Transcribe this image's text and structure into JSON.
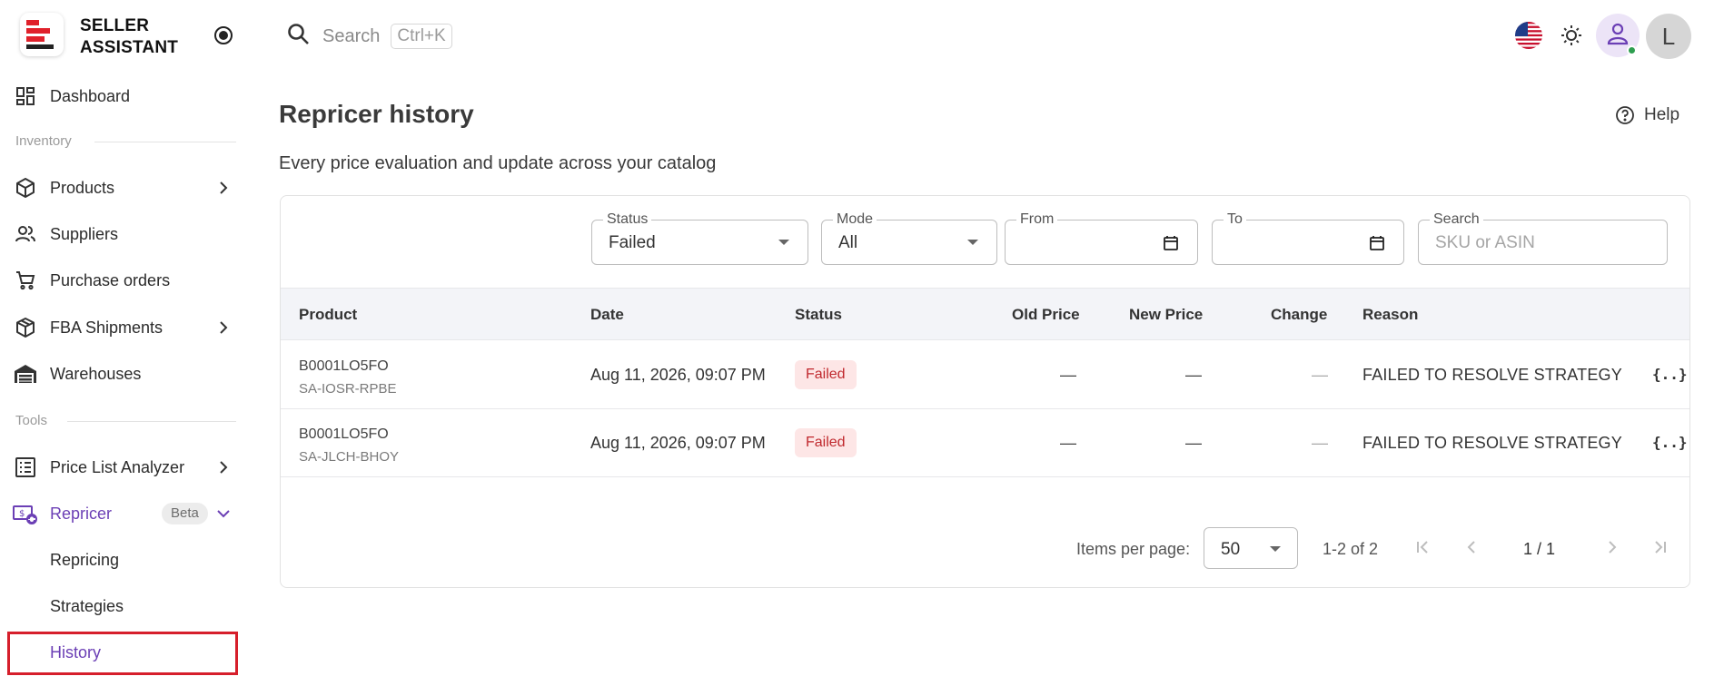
{
  "brand": {
    "line1": "SELLER",
    "line2": "ASSISTANT"
  },
  "search": {
    "placeholder": "Search",
    "shortcut": "Ctrl+K"
  },
  "header": {
    "avatar_letter": "L"
  },
  "sidebar": {
    "dashboard": "Dashboard",
    "inventory_section": "Inventory",
    "products": "Products",
    "suppliers": "Suppliers",
    "purchase_orders": "Purchase orders",
    "fba_shipments": "FBA Shipments",
    "warehouses": "Warehouses",
    "tools_section": "Tools",
    "price_list_analyzer": "Price List Analyzer",
    "repricer": "Repricer",
    "repricer_badge": "Beta",
    "repricing": "Repricing",
    "strategies": "Strategies",
    "history": "History"
  },
  "page": {
    "title": "Repricer history",
    "subtitle": "Every price evaluation and update across your catalog",
    "help": "Help"
  },
  "filters": {
    "status": {
      "label": "Status",
      "value": "Failed"
    },
    "mode": {
      "label": "Mode",
      "value": "All"
    },
    "from": {
      "label": "From",
      "value": ""
    },
    "to": {
      "label": "To",
      "value": ""
    },
    "search": {
      "label": "Search",
      "placeholder": "SKU or ASIN"
    }
  },
  "table": {
    "columns": [
      "Product",
      "Date",
      "Status",
      "Old Price",
      "New Price",
      "Change",
      "Reason"
    ],
    "rows": [
      {
        "asin": "B0001LO5FO",
        "sku": "SA-IOSR-RPBE",
        "date": "Aug 11, 2026, 09:07 PM",
        "status": "Failed",
        "old_price": "—",
        "new_price": "—",
        "change": "—",
        "reason": "FAILED TO RESOLVE STRATEGY",
        "details": "{..}"
      },
      {
        "asin": "B0001LO5FO",
        "sku": "SA-JLCH-BHOY",
        "date": "Aug 11, 2026, 09:07 PM",
        "status": "Failed",
        "old_price": "—",
        "new_price": "—",
        "change": "—",
        "reason": "FAILED TO RESOLVE STRATEGY",
        "details": "{..}"
      }
    ]
  },
  "pagination": {
    "items_per_page_label": "Items per page:",
    "items_per_page": "50",
    "range": "1-2 of 2",
    "page": "1 / 1"
  },
  "colors": {
    "accent": "#6b3fb5",
    "failed_bg": "#fde6e6",
    "failed_text": "#c0282d",
    "highlight": "#d61f2b"
  }
}
